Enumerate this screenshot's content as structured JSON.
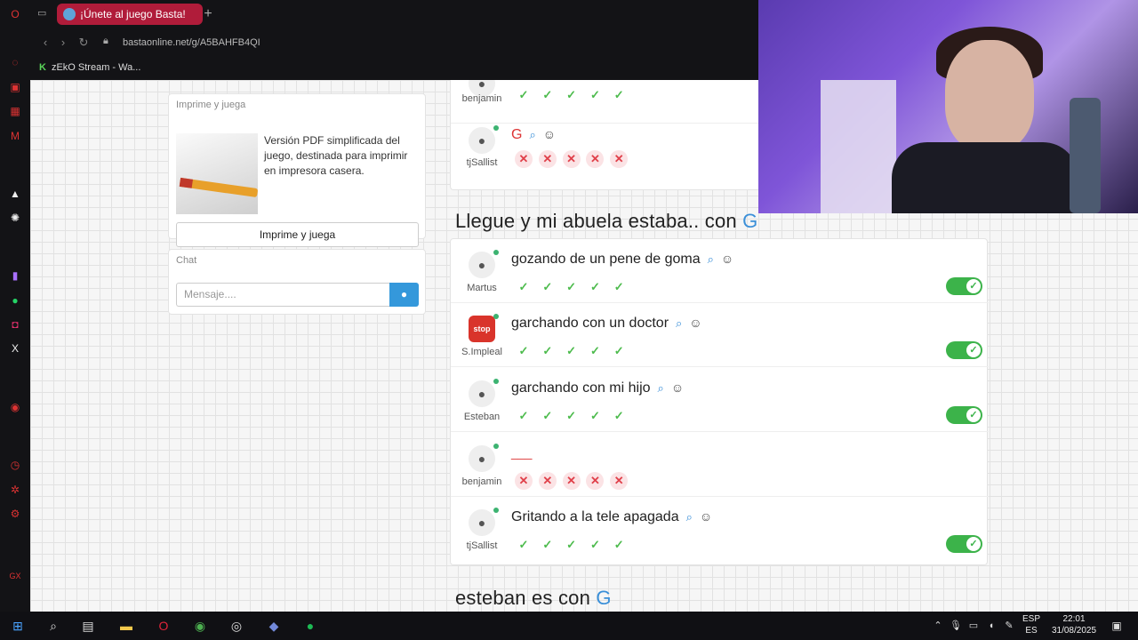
{
  "browser": {
    "tab_title": "¡Únete al juego Basta!",
    "url": "bastaonline.net/g/A5BAHFB4QI",
    "bookmark": "zEkO Stream - Wa..."
  },
  "sidebar_left": {
    "print_header": "Imprime y juega",
    "print_text": "Versión PDF simplificada del juego, destinada para imprimir en impresora casera.",
    "print_button": "Imprime y juega",
    "chat_header": "Chat",
    "chat_placeholder": "Mensaje...."
  },
  "top_block": {
    "rows": [
      {
        "user": "benjamin",
        "answer": "",
        "marks": [
          "ok",
          "ok",
          "ok",
          "ok",
          "ok"
        ]
      },
      {
        "user": "tjSallist",
        "answer": "G",
        "marks": [
          "bad",
          "bad",
          "bad",
          "bad",
          "bad"
        ]
      }
    ]
  },
  "round": {
    "title": "Llegue y mi abuela estaba.. con",
    "letter": "G",
    "rows": [
      {
        "user": "Martus",
        "answer": "gozando de un pene de goma",
        "marks": [
          "ok",
          "ok",
          "ok",
          "ok",
          "ok"
        ],
        "accepted": true,
        "avatar": "person"
      },
      {
        "user": "S.Impleal",
        "answer": "garchando con un doctor",
        "marks": [
          "ok",
          "ok",
          "ok",
          "ok",
          "ok"
        ],
        "accepted": true,
        "avatar": "stop"
      },
      {
        "user": "Esteban",
        "answer": "garchando con mi hijo",
        "marks": [
          "ok",
          "ok",
          "ok",
          "ok",
          "ok"
        ],
        "accepted": true,
        "avatar": "person"
      },
      {
        "user": "benjamin",
        "answer": "___",
        "marks": [
          "bad",
          "bad",
          "bad",
          "bad",
          "bad"
        ],
        "accepted": false,
        "avatar": "person"
      },
      {
        "user": "tjSallist",
        "answer": "Gritando a la tele apagada",
        "marks": [
          "ok",
          "ok",
          "ok",
          "ok",
          "ok"
        ],
        "accepted": true,
        "avatar": "person"
      }
    ]
  },
  "next_round": {
    "title": "esteban es con",
    "letter": "G"
  },
  "taskbar": {
    "lang_top": "ESP",
    "lang_bottom": "ES",
    "time": "22:01",
    "date": "31/08/2025"
  },
  "colors": {
    "accent": "#3a8fd8",
    "ok": "#4cbb4c",
    "bad": "#e0404a",
    "tab": "#b01c3a"
  }
}
